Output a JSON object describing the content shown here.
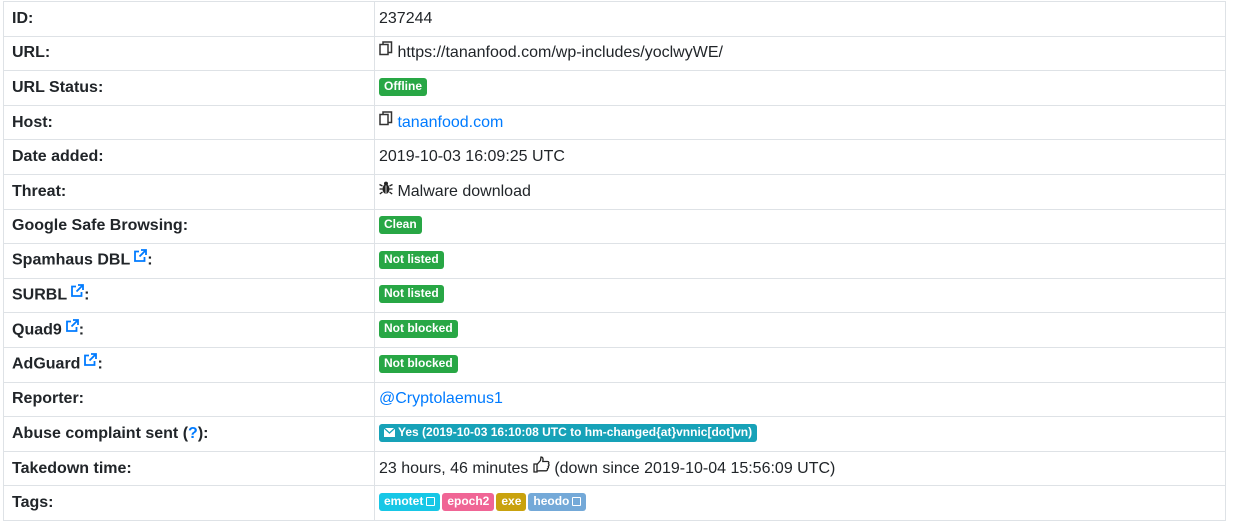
{
  "rows": [
    {
      "label": "ID:",
      "value": "237244"
    },
    {
      "label": "URL:",
      "value": "https://tananfood.com/wp-includes/yoclwyWE/",
      "icon": "copy-icon"
    },
    {
      "label": "URL Status:",
      "badge": "Offline"
    },
    {
      "label": "Host:",
      "link": "tananfood.com",
      "icon": "copy-icon"
    },
    {
      "label": "Date added:",
      "value": "2019-10-03 16:09:25 UTC"
    },
    {
      "label": "Threat:",
      "value": "Malware download",
      "icon": "bug-icon"
    },
    {
      "label": "Google Safe Browsing:",
      "badge": "Clean"
    },
    {
      "label": "Spamhaus DBL",
      "suffix": ":",
      "badge": "Not listed",
      "icon": "external-link-icon"
    },
    {
      "label": "SURBL",
      "suffix": ":",
      "badge": "Not listed",
      "icon": "external-link-icon"
    },
    {
      "label": "Quad9",
      "suffix": ":",
      "badge": "Not blocked",
      "icon": "external-link-icon"
    },
    {
      "label": "AdGuard",
      "suffix": ":",
      "badge": "Not blocked",
      "icon": "external-link-icon"
    },
    {
      "label": "Reporter:",
      "link": "@Cryptolaemus1"
    },
    {
      "label_pre": "Abuse complaint sent (",
      "label_link": "?",
      "label_post": "):",
      "badge": "Yes (2019-10-03 16:10:08 UTC to hm-changed{at}vnnic[dot]vn)",
      "icon": "envelope-icon"
    },
    {
      "label": "Takedown time:",
      "value_pre": "23 hours, 46 minutes",
      "value_post": "(down since 2019-10-04 15:56:09 UTC)",
      "icon": "thumbs-up-icon"
    },
    {
      "label": "Tags:",
      "tags": [
        {
          "text": "emotet",
          "color": "#17c7e6"
        },
        {
          "text": "epoch2",
          "color": "#f06595"
        },
        {
          "text": "exe",
          "color": "#c9a20e"
        },
        {
          "text": "heodo",
          "color": "#74a9d8"
        }
      ]
    }
  ],
  "colors": {
    "badge_green": "#28a745",
    "badge_teal": "#17a2b8",
    "link": "#007bff"
  }
}
